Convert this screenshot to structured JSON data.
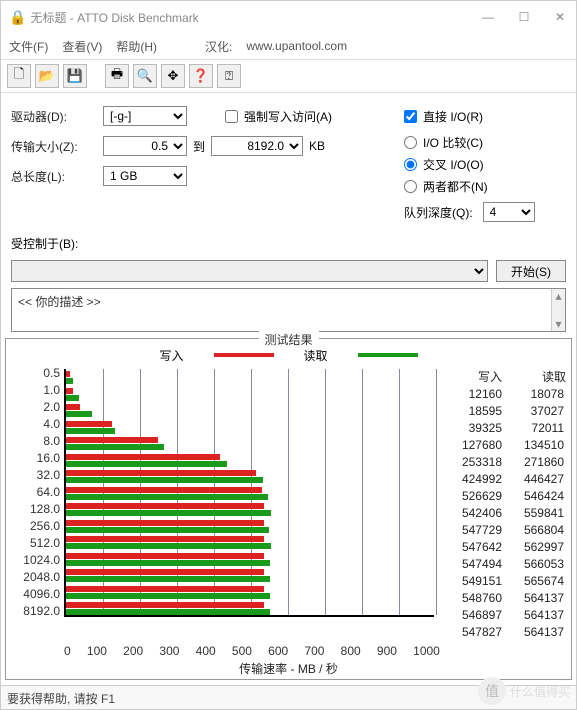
{
  "window": {
    "title": "无标题 - ATTO Disk Benchmark"
  },
  "menu": {
    "file": "文件(F)",
    "view": "查看(V)",
    "help": "帮助(H)",
    "trans_label": "汉化:",
    "trans_url": "www.upantool.com"
  },
  "form": {
    "drive_label": "驱动器(D):",
    "drive_value": "[-g-]",
    "force_write": "强制写入访问(A)",
    "direct_io": "直接 I/O(R)",
    "size_label": "传输大小(Z):",
    "size_from": "0.5",
    "size_to_label": "到",
    "size_to": "8192.0",
    "size_unit": "KB",
    "io_compare": "I/O 比较(C)",
    "io_overlap": "交叉 I/O(O)",
    "io_neither": "两者都不(N)",
    "length_label": "总长度(L):",
    "length_value": "1 GB",
    "queue_label": "队列深度(Q):",
    "queue_value": "4",
    "controlled_label": "受控制于(B):",
    "start_btn": "开始(S)",
    "desc_text": "<<   你的描述    >>"
  },
  "results": {
    "title": "测试结果",
    "write_legend": "写入",
    "read_legend": "读取",
    "write_col": "写入",
    "read_col": "读取",
    "xlabel": "传输速率 - MB / 秒"
  },
  "chart_data": {
    "type": "bar",
    "xlabel": "传输速率 - MB / 秒",
    "xlim": [
      0,
      1000
    ],
    "xticks": [
      0,
      100,
      200,
      300,
      400,
      500,
      600,
      700,
      800,
      900,
      1000
    ],
    "categories": [
      "0.5",
      "1.0",
      "2.0",
      "4.0",
      "8.0",
      "16.0",
      "32.0",
      "64.0",
      "128.0",
      "256.0",
      "512.0",
      "1024.0",
      "2048.0",
      "4096.0",
      "8192.0"
    ],
    "series": [
      {
        "name": "写入",
        "color": "#d22",
        "values_kb": [
          12160,
          18595,
          39325,
          127680,
          253318,
          424992,
          526629,
          542406,
          547729,
          547642,
          547494,
          549151,
          548760,
          546897,
          547827
        ]
      },
      {
        "name": "读取",
        "color": "#1a9a1a",
        "values_kb": [
          18078,
          37027,
          72011,
          134510,
          271860,
          446427,
          546424,
          559841,
          566804,
          562997,
          566053,
          565674,
          564137,
          564137,
          564137
        ]
      }
    ]
  },
  "status": {
    "help": "要获得帮助, 请按 F1"
  },
  "watermark": {
    "text": "什么值得买"
  }
}
